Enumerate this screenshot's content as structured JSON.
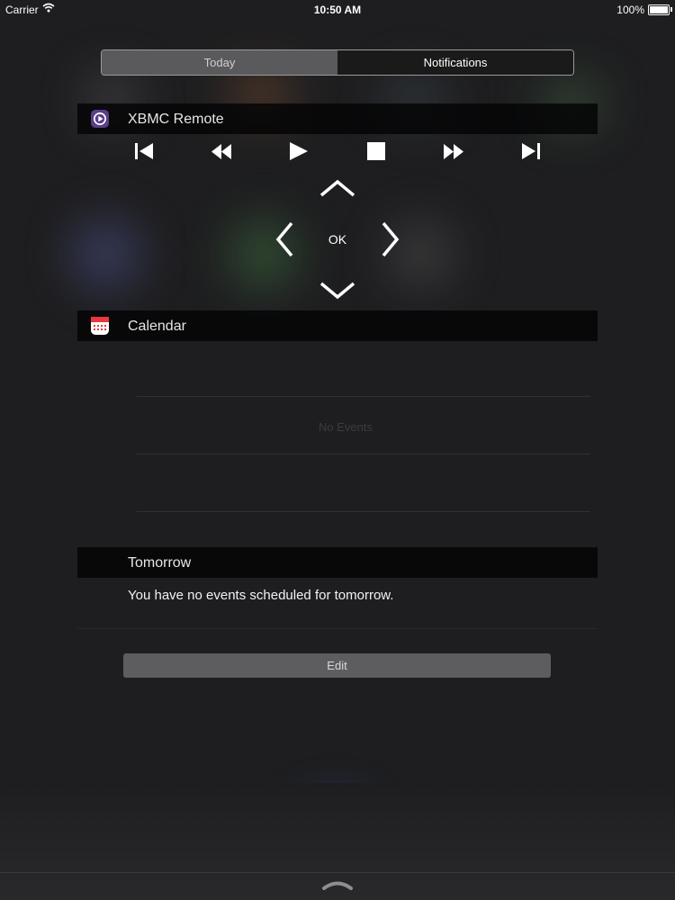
{
  "status_bar": {
    "carrier": "Carrier",
    "time": "10:50 AM",
    "battery": "100%"
  },
  "segmented": {
    "today": "Today",
    "notifications": "Notifications",
    "selected": "Today"
  },
  "xbmc": {
    "title": "XBMC Remote",
    "ok_label": "OK",
    "icons": [
      "skip-previous-icon",
      "rewind-icon",
      "play-icon",
      "stop-icon",
      "fast-forward-icon",
      "skip-next-icon",
      "arrow-up-icon",
      "arrow-left-icon",
      "arrow-right-icon",
      "arrow-down-icon"
    ]
  },
  "calendar": {
    "title": "Calendar",
    "no_events": "No Events"
  },
  "tomorrow": {
    "title": "Tomorrow",
    "message": "You have no events scheduled for tomorrow."
  },
  "edit_label": "Edit",
  "colors": {
    "background": "#1e1e20",
    "header_bar": "#050506",
    "segment_active": "#5a5a5c",
    "button_gray": "#5d5d5f",
    "xbmc_icon": "#5b3d88"
  }
}
